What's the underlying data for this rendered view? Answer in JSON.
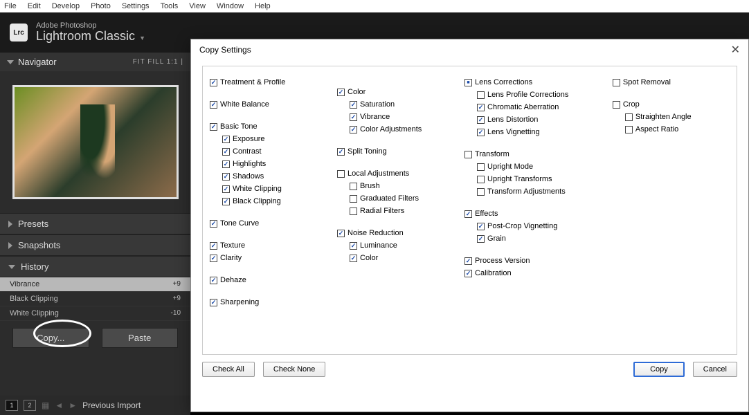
{
  "menubar": [
    "File",
    "Edit",
    "Develop",
    "Photo",
    "Settings",
    "Tools",
    "View",
    "Window",
    "Help"
  ],
  "app": {
    "brand_small": "Adobe Photoshop",
    "brand_big": "Lightroom Classic",
    "logo": "Lrc"
  },
  "navigator": {
    "title": "Navigator",
    "zoom": "FIT   FILL   1:1   |"
  },
  "sections": {
    "presets": "Presets",
    "snapshots": "Snapshots",
    "history": "History"
  },
  "history": [
    {
      "label": "Vibrance",
      "val": "+9",
      "sel": true
    },
    {
      "label": "Black Clipping",
      "val": "+9",
      "sel": false
    },
    {
      "label": "White Clipping",
      "val": "-10",
      "sel": false
    }
  ],
  "copy_paste": {
    "copy": "Copy...",
    "paste": "Paste"
  },
  "filmstrip": {
    "n1": "1",
    "n2": "2",
    "prev": "Previous Import"
  },
  "dialog": {
    "title": "Copy Settings",
    "col1": [
      {
        "label": "Treatment & Profile",
        "c": true
      },
      {
        "spacer": true
      },
      {
        "label": "White Balance",
        "c": true
      },
      {
        "spacer": true
      },
      {
        "label": "Basic Tone",
        "c": true
      },
      {
        "label": "Exposure",
        "c": true,
        "sub": true
      },
      {
        "label": "Contrast",
        "c": true,
        "sub": true
      },
      {
        "label": "Highlights",
        "c": true,
        "sub": true
      },
      {
        "label": "Shadows",
        "c": true,
        "sub": true
      },
      {
        "label": "White Clipping",
        "c": true,
        "sub": true
      },
      {
        "label": "Black Clipping",
        "c": true,
        "sub": true
      },
      {
        "spacer": true
      },
      {
        "label": "Tone Curve",
        "c": true
      },
      {
        "spacer": true
      },
      {
        "label": "Texture",
        "c": true
      },
      {
        "label": "Clarity",
        "c": true
      },
      {
        "spacer": true
      },
      {
        "label": "Dehaze",
        "c": true
      },
      {
        "spacer": true
      },
      {
        "label": "Sharpening",
        "c": true
      }
    ],
    "col2": [
      {
        "label": "Color",
        "c": true
      },
      {
        "label": "Saturation",
        "c": true,
        "sub": true
      },
      {
        "label": "Vibrance",
        "c": true,
        "sub": true
      },
      {
        "label": "Color Adjustments",
        "c": true,
        "sub": true
      },
      {
        "spacer": true
      },
      {
        "label": "Split Toning",
        "c": true
      },
      {
        "spacer": true
      },
      {
        "label": "Local Adjustments",
        "c": false
      },
      {
        "label": "Brush",
        "c": false,
        "sub": true
      },
      {
        "label": "Graduated Filters",
        "c": false,
        "sub": true
      },
      {
        "label": "Radial Filters",
        "c": false,
        "sub": true
      },
      {
        "spacer": true
      },
      {
        "label": "Noise Reduction",
        "c": true
      },
      {
        "label": "Luminance",
        "c": true,
        "sub": true
      },
      {
        "label": "Color",
        "c": true,
        "sub": true
      }
    ],
    "col3": [
      {
        "label": "Lens Corrections",
        "c": "mixed"
      },
      {
        "label": "Lens Profile Corrections",
        "c": false,
        "sub": true
      },
      {
        "label": "Chromatic Aberration",
        "c": true,
        "sub": true
      },
      {
        "label": "Lens Distortion",
        "c": true,
        "sub": true
      },
      {
        "label": "Lens Vignetting",
        "c": true,
        "sub": true
      },
      {
        "spacer": true
      },
      {
        "label": "Transform",
        "c": false
      },
      {
        "label": "Upright Mode",
        "c": false,
        "sub": true
      },
      {
        "label": "Upright Transforms",
        "c": false,
        "sub": true
      },
      {
        "label": "Transform Adjustments",
        "c": false,
        "sub": true
      },
      {
        "spacer": true
      },
      {
        "label": "Effects",
        "c": true
      },
      {
        "label": "Post-Crop Vignetting",
        "c": true,
        "sub": true
      },
      {
        "label": "Grain",
        "c": true,
        "sub": true
      },
      {
        "spacer": true
      },
      {
        "label": "Process Version",
        "c": true
      },
      {
        "label": "Calibration",
        "c": true
      }
    ],
    "col4": [
      {
        "label": "Spot Removal",
        "c": false
      },
      {
        "spacer": true
      },
      {
        "label": "Crop",
        "c": false
      },
      {
        "label": "Straighten Angle",
        "c": false,
        "sub": true
      },
      {
        "label": "Aspect Ratio",
        "c": false,
        "sub": true
      }
    ],
    "buttons": {
      "check_all": "Check All",
      "check_none": "Check None",
      "copy": "Copy",
      "cancel": "Cancel"
    }
  }
}
